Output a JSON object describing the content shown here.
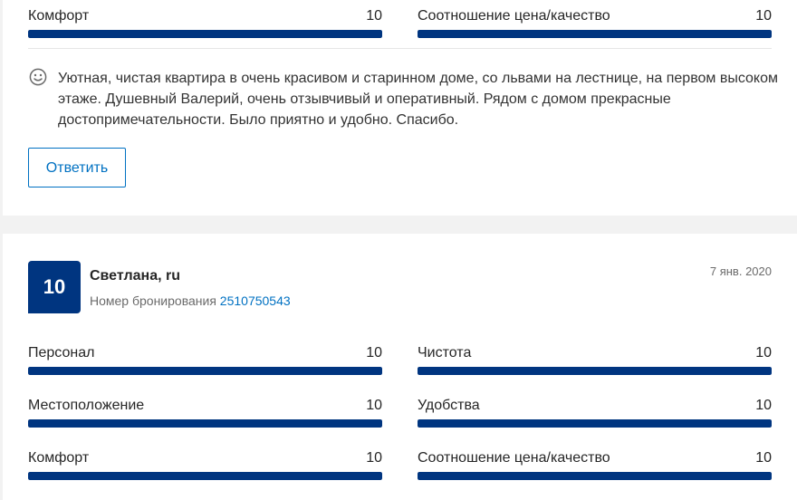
{
  "review1": {
    "ratings_bottom": [
      {
        "label": "Комфорт",
        "value": "10",
        "score": 1.0
      },
      {
        "label": "Соотношение цена/качество",
        "value": "10",
        "score": 1.0
      }
    ],
    "text": "Уютная, чистая квартира в очень красивом и старинном доме, со львами на лестнице, на первом высоком этаже. Душевный Валерий, очень отзывчивый и оперативный. Рядом с домом прекрасные достопримечательности. Было приятно и удобно. Спасибо.",
    "reply_label": "Ответить",
    "sentiment_icon": "smile-icon"
  },
  "review2": {
    "score": "10",
    "name": "Светлана, ru",
    "booking_label": "Номер бронирования",
    "booking_number": "2510750543",
    "date": "7 янв. 2020",
    "ratings": [
      {
        "label": "Персонал",
        "value": "10",
        "score": 1.0
      },
      {
        "label": "Чистота",
        "value": "10",
        "score": 1.0
      },
      {
        "label": "Местоположение",
        "value": "10",
        "score": 1.0
      },
      {
        "label": "Удобства",
        "value": "10",
        "score": 1.0
      },
      {
        "label": "Комфорт",
        "value": "10",
        "score": 1.0
      },
      {
        "label": "Соотношение цена/качество",
        "value": "10",
        "score": 1.0
      }
    ]
  },
  "colors": {
    "bar_fill": "#003580",
    "link": "#0071c2",
    "badge": "#003580"
  }
}
